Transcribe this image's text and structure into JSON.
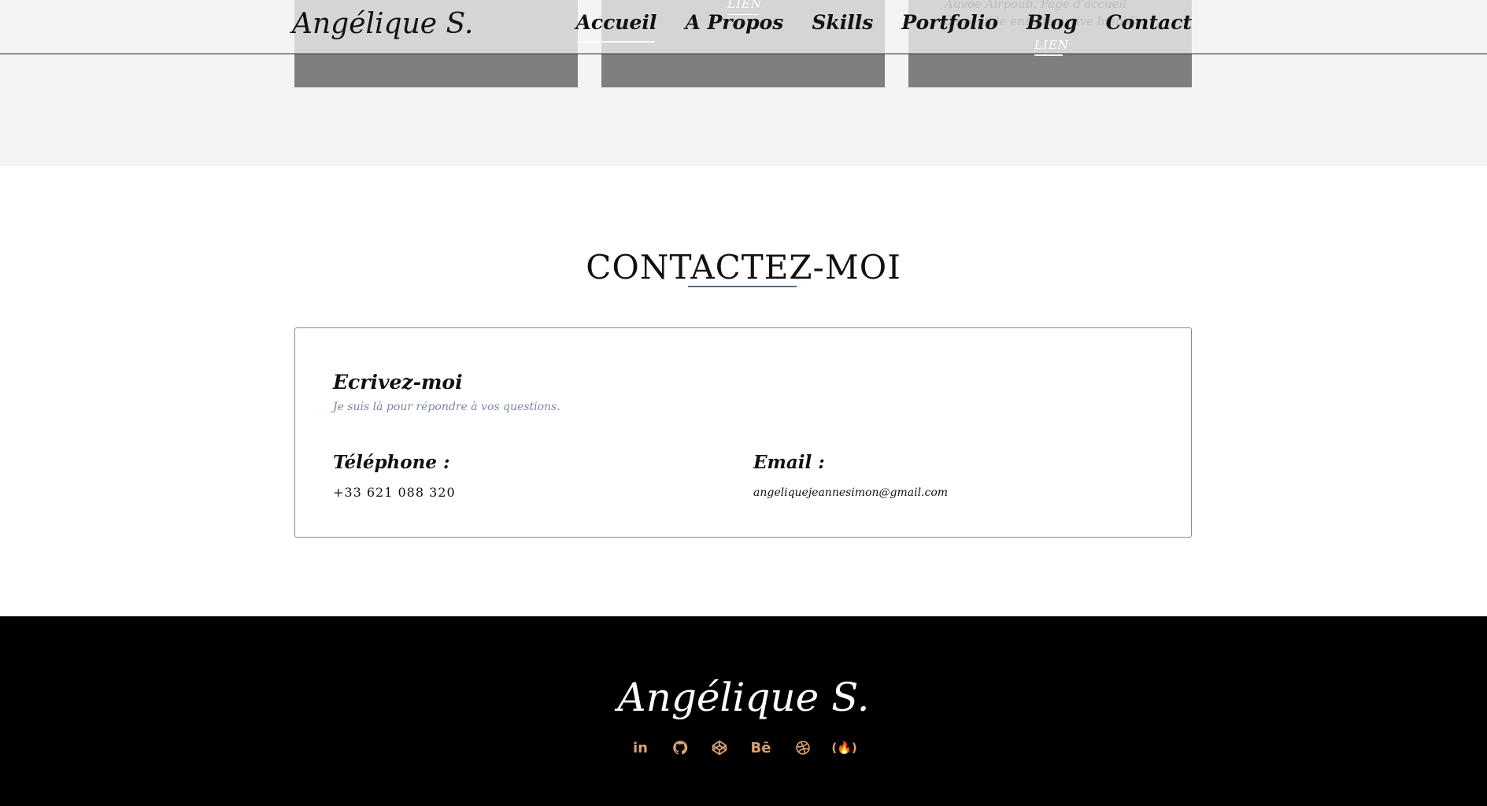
{
  "header": {
    "logo": "Angélique S.",
    "nav": [
      {
        "label": "Accueil",
        "active": true
      },
      {
        "label": "A Propos"
      },
      {
        "label": "Skills"
      },
      {
        "label": "Portfolio"
      },
      {
        "label": "Blog"
      },
      {
        "label": "Contact"
      }
    ]
  },
  "portfolio": {
    "cards": [
      {
        "link": ""
      },
      {
        "link": "LIEN"
      },
      {
        "link": "LIEN",
        "description": "Auvoe Airpoub. Page d'accueil disponible ensuite arrive bientôt."
      }
    ]
  },
  "contact": {
    "title": "CONTACTEZ-MOI",
    "card": {
      "heading": "Ecrivez-moi",
      "subtitle": "Je suis là pour répondre à vos questions.",
      "phone_label": "Téléphone :",
      "phone_value": "+33 621 088 320",
      "email_label": "Email :",
      "email_value": "angeliquejeannesimon@gmail.com"
    }
  },
  "footer": {
    "logo": "Angélique S.",
    "social": [
      {
        "name": "linkedin-icon",
        "label": "in"
      },
      {
        "name": "github-icon"
      },
      {
        "name": "codepen-icon"
      },
      {
        "name": "behance-icon",
        "label": "Bē"
      },
      {
        "name": "dribbble-icon"
      },
      {
        "name": "freecodecamp-icon",
        "label": "(🔥)"
      }
    ],
    "accent_color": "#d9a273"
  }
}
